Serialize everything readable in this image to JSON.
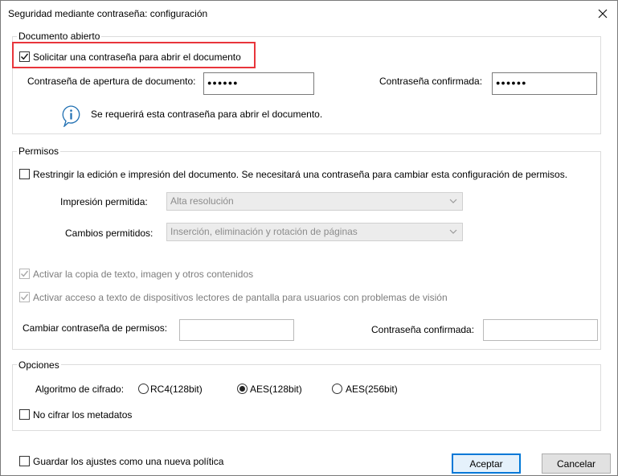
{
  "window": {
    "title": "Seguridad mediante contraseña: configuración"
  },
  "open_doc": {
    "legend": "Documento abierto",
    "require_label": "Solicitar una contraseña para abrir el documento",
    "require_checked": true,
    "password_label": "Contraseña de apertura de documento:",
    "password_value": "●●●●●●",
    "confirm_label": "Contraseña confirmada:",
    "confirm_value": "●●●●●●",
    "info_text": "Se requerirá esta contraseña para abrir el documento."
  },
  "permissions": {
    "legend": "Permisos",
    "restrict_label": "Restringir la edición e impresión del documento. Se necesitará una contraseña para cambiar esta configuración de permisos.",
    "restrict_checked": false,
    "print_label": "Impresión permitida:",
    "print_value": "Alta resolución",
    "changes_label": "Cambios permitidos:",
    "changes_value": "Inserción, eliminación y rotación de páginas",
    "copy_label": "Activar la copia de texto, imagen y otros contenidos",
    "copy_checked": true,
    "reader_label": "Activar acceso a texto de dispositivos lectores de pantalla para usuarios con problemas de visión",
    "reader_checked": true,
    "change_pw_label": "Cambiar contraseña de permisos:",
    "change_pw_value": "",
    "confirm_label": "Contraseña confirmada:",
    "confirm_value": ""
  },
  "options": {
    "legend": "Opciones",
    "algo_label": "Algoritmo de cifrado:",
    "algorithms": [
      {
        "label": "RC4(128bit)",
        "selected": false
      },
      {
        "label": "AES(128bit)",
        "selected": true
      },
      {
        "label": "AES(256bit)",
        "selected": false
      }
    ],
    "no_meta_label": "No cifrar los metadatos",
    "no_meta_checked": false
  },
  "footer": {
    "save_policy_label": "Guardar los ajustes como una nueva política",
    "save_policy_checked": false,
    "accept_label": "Aceptar",
    "cancel_label": "Cancelar"
  },
  "colors": {
    "highlight": "#e8353b",
    "default_button_border": "#0078d7",
    "info_icon": "#1f6fb2"
  }
}
